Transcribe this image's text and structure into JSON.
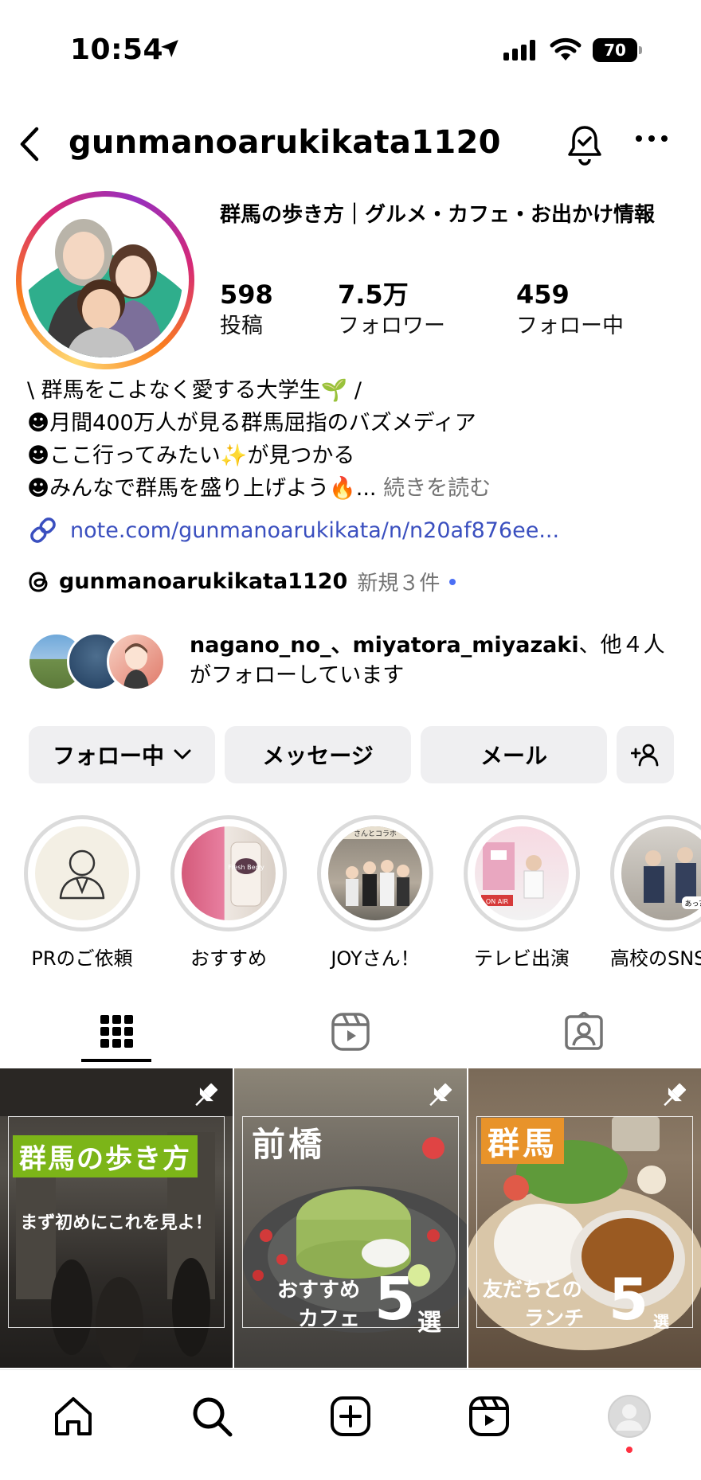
{
  "status_bar": {
    "time": "10:54",
    "battery": "70"
  },
  "header": {
    "username": "gunmanoarukikata1120"
  },
  "profile": {
    "full_name": "群馬の歩き方｜グルメ・カフェ・お出かけ情報",
    "stats": [
      {
        "value": "598",
        "label": "投稿"
      },
      {
        "value": "7.5万",
        "label": "フォロワー"
      },
      {
        "value": "459",
        "label": "フォロー中"
      }
    ],
    "bio_lines": [
      "\\ 群馬をこよなく愛する大学生🌱 /",
      "☻月間400万人が見る群馬屈指のバズメディア",
      "☻ここ行ってみたい✨が見つかる",
      "☻みんなで群馬を盛り上げよう🔥..."
    ],
    "bio_more": " 続きを読む",
    "link": "note.com/gunmanoarukikata/n/n20af876ee...",
    "threads_name": "gunmanoarukikata1120",
    "threads_new": "新規３件"
  },
  "followed_by": {
    "names": "nagano_no_、miyatora_miyazaki",
    "suffix": "、他４人がフォローしています"
  },
  "buttons": {
    "following": "フォロー中",
    "message": "メッセージ",
    "email": "メール"
  },
  "highlights": [
    {
      "label": "PRのご依頼"
    },
    {
      "label": "おすすめ"
    },
    {
      "label": "JOYさん！"
    },
    {
      "label": "テレビ出演"
    },
    {
      "label": "高校のSNS"
    }
  ],
  "posts": [
    {
      "title": "群馬の歩き方",
      "subtitle": "まず初めにこれを見よ！"
    },
    {
      "title": "前橋",
      "line1": "おすすめ",
      "line2": "カフェ",
      "number": "5",
      "unit": "選"
    },
    {
      "title": "群馬",
      "line1": "友だちとの",
      "line2": "ランチ",
      "number": "5",
      "unit": "選"
    }
  ],
  "highlight_mini_text": {
    "joy_banner": "さんとコラボ",
    "tv_badge": "ON AIR",
    "school_bubble": "あっ？",
    "cup_text": "Fresh Berry"
  },
  "colors": {
    "link": "#3a4fbf",
    "button_bg": "#efeff1",
    "title_green": "#7cb518",
    "title_orange": "#e8932a",
    "notification_dot": "#ff3040"
  }
}
